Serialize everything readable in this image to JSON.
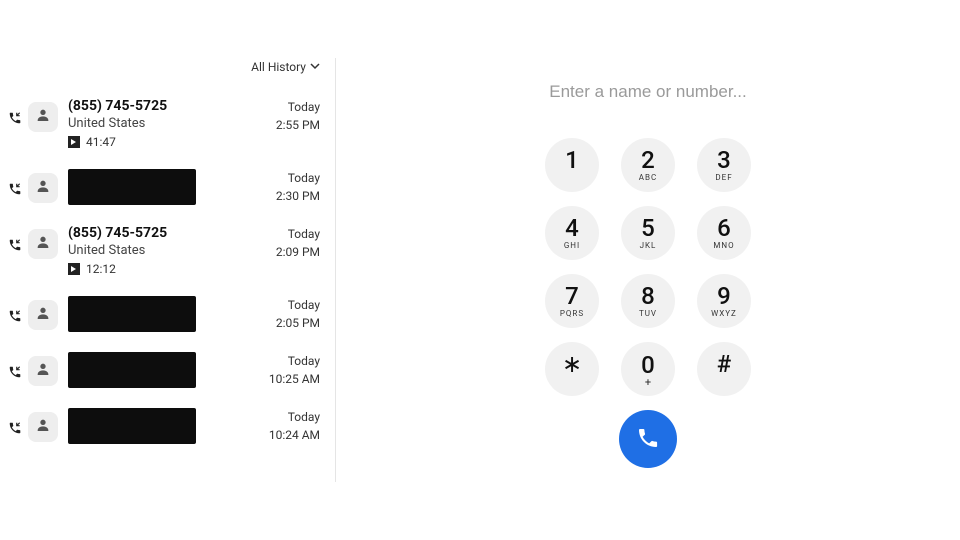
{
  "filter": {
    "label": "All History"
  },
  "calls": [
    {
      "title": "(855) 745-5725",
      "sub": "United States",
      "voicemail": "41:47",
      "redacted": false,
      "day": "Today",
      "time": "2:55 PM"
    },
    {
      "title": "",
      "sub": "",
      "voicemail": null,
      "redacted": true,
      "day": "Today",
      "time": "2:30 PM"
    },
    {
      "title": "(855) 745-5725",
      "sub": "United States",
      "voicemail": "12:12",
      "redacted": false,
      "day": "Today",
      "time": "2:09 PM"
    },
    {
      "title": "",
      "sub": "",
      "voicemail": null,
      "redacted": true,
      "day": "Today",
      "time": "2:05 PM"
    },
    {
      "title": "",
      "sub": "",
      "voicemail": null,
      "redacted": true,
      "day": "Today",
      "time": "10:25 AM"
    },
    {
      "title": "",
      "sub": "",
      "voicemail": null,
      "redacted": true,
      "day": "Today",
      "time": "10:24 AM"
    }
  ],
  "dialer": {
    "placeholder": "Enter a name or number...",
    "keys": [
      {
        "digit": "1",
        "letters": ""
      },
      {
        "digit": "2",
        "letters": "ABC"
      },
      {
        "digit": "3",
        "letters": "DEF"
      },
      {
        "digit": "4",
        "letters": "GHI"
      },
      {
        "digit": "5",
        "letters": "JKL"
      },
      {
        "digit": "6",
        "letters": "MNO"
      },
      {
        "digit": "7",
        "letters": "PQRS"
      },
      {
        "digit": "8",
        "letters": "TUV"
      },
      {
        "digit": "9",
        "letters": "WXYZ"
      },
      {
        "digit": "∗",
        "letters": ""
      },
      {
        "digit": "0",
        "letters": "+"
      },
      {
        "digit": "#",
        "letters": ""
      }
    ]
  }
}
